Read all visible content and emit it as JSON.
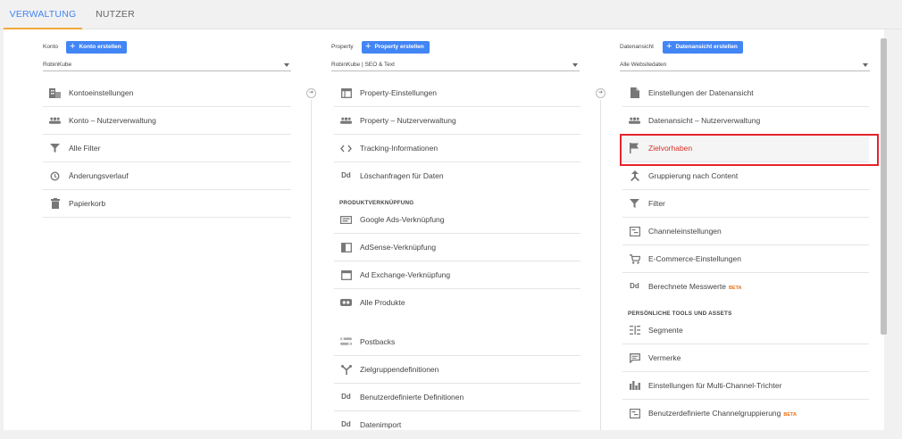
{
  "tabs": [
    {
      "label": "VERWALTUNG"
    },
    {
      "label": "NUTZER"
    }
  ],
  "konto": {
    "heading": "Konto",
    "create_label": "Konto erstellen",
    "selected": "RobinKube",
    "items": [
      {
        "label": "Kontoeinstellungen",
        "icon": "building-icon"
      },
      {
        "label": "Konto – Nutzerverwaltung",
        "icon": "users-icon"
      },
      {
        "label": "Alle Filter",
        "icon": "filter-icon"
      },
      {
        "label": "Änderungsverlauf",
        "icon": "history-icon"
      },
      {
        "label": "Papierkorb",
        "icon": "trash-icon"
      }
    ]
  },
  "property": {
    "heading": "Property",
    "create_label": "Property erstellen",
    "selected": "RobinKube | SEO & Text",
    "items": [
      {
        "label": "Property-Einstellungen",
        "icon": "window-icon"
      },
      {
        "label": "Property – Nutzerverwaltung",
        "icon": "users-icon"
      },
      {
        "label": "Tracking-Informationen",
        "icon": "code-icon"
      },
      {
        "label": "Löschanfragen für Daten",
        "icon": "dd-icon"
      }
    ],
    "section": "PRODUKTVERKNÜPFUNG",
    "product_items": [
      {
        "label": "Google Ads-Verknüpfung",
        "icon": "ads-icon"
      },
      {
        "label": "AdSense-Verknüpfung",
        "icon": "adsense-icon"
      },
      {
        "label": "Ad Exchange-Verknüpfung",
        "icon": "adexchange-icon"
      },
      {
        "label": "Alle Produkte",
        "icon": "link-icon"
      }
    ],
    "more_items": [
      {
        "label": "Postbacks",
        "icon": "postbacks-icon"
      },
      {
        "label": "Zielgruppendefinitionen",
        "icon": "audience-icon"
      },
      {
        "label": "Benutzerdefinierte Definitionen",
        "icon": "dd-icon"
      },
      {
        "label": "Datenimport",
        "icon": "dd-icon"
      }
    ]
  },
  "view": {
    "heading": "Datenansicht",
    "create_label": "Datenansicht erstellen",
    "selected": "Alle Websitedaten",
    "items": [
      {
        "label": "Einstellungen der Datenansicht",
        "icon": "document-icon"
      },
      {
        "label": "Datenansicht – Nutzerverwaltung",
        "icon": "users-icon"
      },
      {
        "label": "Zielvorhaben",
        "icon": "flag-icon"
      },
      {
        "label": "Gruppierung nach Content",
        "icon": "grouping-icon"
      },
      {
        "label": "Filter",
        "icon": "filter-icon"
      },
      {
        "label": "Channeleinstellungen",
        "icon": "channel-icon"
      },
      {
        "label": "E-Commerce-Einstellungen",
        "icon": "cart-icon"
      },
      {
        "label": "Berechnete Messwerte",
        "icon": "dd-icon",
        "badge": "BETA"
      }
    ],
    "section": "PERSÖNLICHE TOOLS UND ASSETS",
    "personal_items": [
      {
        "label": "Segmente",
        "icon": "segments-icon"
      },
      {
        "label": "Vermerke",
        "icon": "comment-icon"
      },
      {
        "label": "Einstellungen für Multi-Channel-Trichter",
        "icon": "bar-chart-icon"
      },
      {
        "label": "Benutzerdefinierte Channelgruppierung",
        "icon": "channel-icon",
        "badge": "BETA"
      }
    ]
  },
  "colors": {
    "accent": "#4285f4",
    "highlight": "#e5242c",
    "tab_underline": "#f2a93b",
    "beta": "#e8711a"
  }
}
